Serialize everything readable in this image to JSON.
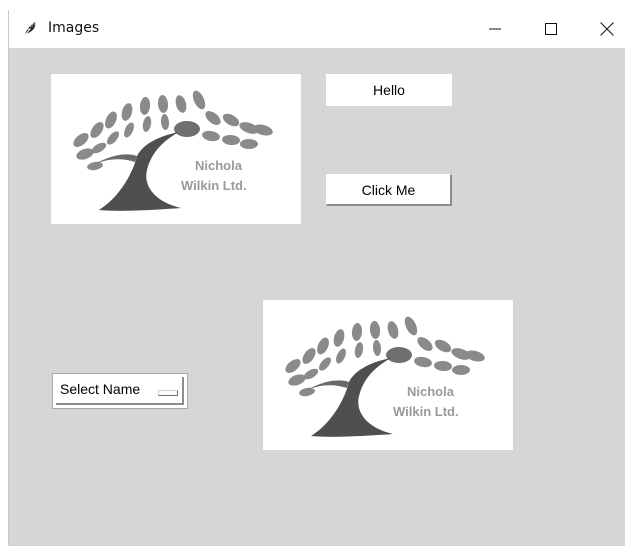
{
  "window": {
    "title": "Images",
    "controls": {
      "minimize": "minimize-icon",
      "maximize": "maximize-icon",
      "close": "close-icon"
    }
  },
  "label": {
    "text": "Hello"
  },
  "button": {
    "label": "Click Me"
  },
  "option_menu": {
    "selected": "Select Name"
  },
  "logo": {
    "line1": "Nichola",
    "line2": "Wilkin Ltd."
  },
  "colors": {
    "window_background": "#d6d6d6",
    "titlebar_background": "#ffffff",
    "logo_gray": "#8a8a8a",
    "logo_dark": "#555555"
  }
}
